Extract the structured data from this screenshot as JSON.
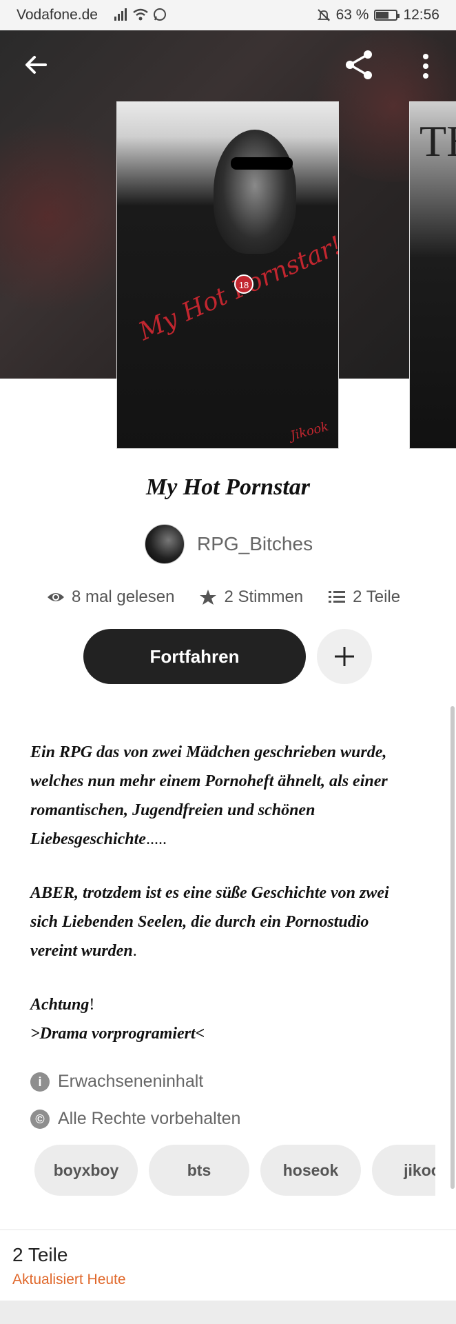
{
  "status_bar": {
    "carrier": "Vodafone.de",
    "battery": "63 %",
    "battery_level": 0.63,
    "time": "12:56"
  },
  "story": {
    "title": "My Hot Pornstar",
    "cover_text": "My Hot Pornstar!",
    "cover_badge": "18",
    "cover_signature": "Jikook",
    "author": "RPG_Bitches",
    "stats": {
      "reads": "8 mal gelesen",
      "votes": "2 Stimmen",
      "parts": "2 Teile"
    },
    "continue_label": "Fortfahren",
    "description": {
      "p1": "Ein RPG das von zwei Mädchen geschrieben wurde, welches nun mehr einem Pornoheft ähnelt, als einer romantischen, Jugendfreien und schönen Liebesgeschichte",
      "p1_suffix": ".....",
      "p2": "ABER, trotzdem ist es eine süße Geschichte von zwei sich Liebenden Seelen, die durch ein Pornostudio vereint wurden",
      "p2_suffix": ".",
      "p3_line1": "Achtung",
      "p3_line1_suffix": "!",
      "p3_line2": ">Drama vorprogramiert<"
    },
    "meta": {
      "mature": "Erwachseneninhalt",
      "copyright": "Alle Rechte vorbehalten"
    },
    "tags": [
      "boyxboy",
      "bts",
      "hoseok",
      "jikoo"
    ],
    "parts_section": {
      "title": "2 Teile",
      "updated": "Aktualisiert Heute"
    }
  },
  "colors": {
    "accent": "#e0682b",
    "button_dark": "#222222"
  }
}
